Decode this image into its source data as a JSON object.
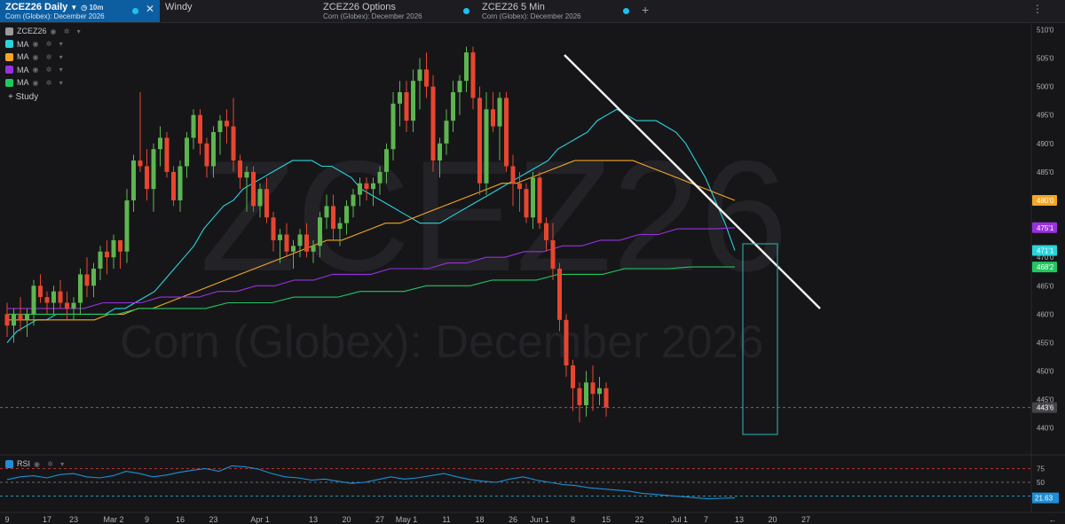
{
  "tabs": [
    {
      "title": "ZCEZ26 Daily",
      "subtitle": "Corn (Globex): December 2026",
      "interval": "10m"
    },
    {
      "title": "Windy",
      "subtitle": ""
    },
    {
      "title": "ZCEZ26 Options",
      "subtitle": "Corn (Globex): December 2026"
    },
    {
      "title": "ZCEZ26 5 Min",
      "subtitle": "Corn (Globex): December 2026"
    }
  ],
  "legend": [
    {
      "label": "ZCEZ26",
      "color": "#9a9a9a"
    },
    {
      "label": "MA",
      "color": "#2ad4dc"
    },
    {
      "label": "MA",
      "color": "#f5a623"
    },
    {
      "label": "MA",
      "color": "#9b30e0"
    },
    {
      "label": "MA",
      "color": "#22c760"
    }
  ],
  "study_label": "+ Study",
  "rsi_label": "RSI",
  "watermark": {
    "symbol": "ZCEZ26",
    "name": "Corn (Globex): December 2026"
  },
  "chart_data": {
    "type": "candlestick",
    "price_axis": {
      "ticks": [
        "510'0",
        "505'0",
        "500'0",
        "495'0",
        "490'0",
        "485'0",
        "480'0",
        "475'0",
        "470'0",
        "465'0",
        "460'0",
        "455'0",
        "450'0",
        "445'0",
        "440'0"
      ],
      "range": [
        437,
        511
      ]
    },
    "price_labels": [
      {
        "text": "480'0",
        "value": 480.0,
        "color": "#f5a623"
      },
      {
        "text": "475'1",
        "value": 475.2,
        "color": "#9b30e0"
      },
      {
        "text": "471'1",
        "value": 471.2,
        "color": "#2ad4dc"
      },
      {
        "text": "468'2",
        "value": 468.3,
        "color": "#22c760"
      },
      {
        "text": "443'6",
        "value": 443.6,
        "color": "#444449"
      }
    ],
    "last_price": 443.6,
    "x_ticks": [
      {
        "label": "9",
        "i": 0
      },
      {
        "label": "17",
        "i": 6
      },
      {
        "label": "23",
        "i": 10
      },
      {
        "label": "Mar 2",
        "i": 16
      },
      {
        "label": "9",
        "i": 21
      },
      {
        "label": "16",
        "i": 26
      },
      {
        "label": "23",
        "i": 31
      },
      {
        "label": "Apr 1",
        "i": 38
      },
      {
        "label": "13",
        "i": 46
      },
      {
        "label": "20",
        "i": 51
      },
      {
        "label": "27",
        "i": 56
      },
      {
        "label": "May 1",
        "i": 60
      },
      {
        "label": "11",
        "i": 66
      },
      {
        "label": "18",
        "i": 71
      },
      {
        "label": "26",
        "i": 76
      },
      {
        "label": "Jun 1",
        "i": 80
      },
      {
        "label": "8",
        "i": 85
      },
      {
        "label": "15",
        "i": 90
      },
      {
        "label": "22",
        "i": 95
      },
      {
        "label": "Jul 1",
        "i": 101
      },
      {
        "label": "7",
        "i": 105
      },
      {
        "label": "13",
        "i": 110
      },
      {
        "label": "20",
        "i": 115
      },
      {
        "label": "27",
        "i": 120
      }
    ],
    "candles": [
      [
        460,
        462,
        456,
        458
      ],
      [
        458,
        461,
        455,
        460
      ],
      [
        460,
        463,
        457,
        459
      ],
      [
        459,
        461,
        456,
        460
      ],
      [
        460,
        466,
        458,
        465
      ],
      [
        465,
        467,
        462,
        463
      ],
      [
        463,
        464,
        460,
        462
      ],
      [
        462,
        465,
        460,
        464
      ],
      [
        464,
        466,
        461,
        462
      ],
      [
        462,
        464,
        459,
        461
      ],
      [
        461,
        463,
        459,
        462
      ],
      [
        462,
        468,
        460,
        467
      ],
      [
        467,
        470,
        463,
        465
      ],
      [
        465,
        469,
        463,
        468
      ],
      [
        468,
        472,
        466,
        471
      ],
      [
        471,
        473,
        467,
        470
      ],
      [
        470,
        474,
        468,
        473
      ],
      [
        473,
        473,
        468,
        471
      ],
      [
        471,
        482,
        469,
        480
      ],
      [
        480,
        488,
        478,
        487
      ],
      [
        487,
        499,
        485,
        486
      ],
      [
        486,
        489,
        480,
        482
      ],
      [
        482,
        490,
        478,
        489
      ],
      [
        489,
        493,
        486,
        491
      ],
      [
        491,
        492,
        484,
        485
      ],
      [
        485,
        486,
        479,
        480
      ],
      [
        480,
        487,
        478,
        486
      ],
      [
        486,
        492,
        484,
        491
      ],
      [
        491,
        496,
        489,
        495
      ],
      [
        495,
        496,
        488,
        490
      ],
      [
        490,
        491,
        484,
        486
      ],
      [
        486,
        493,
        484,
        492
      ],
      [
        492,
        495,
        488,
        494
      ],
      [
        494,
        496,
        490,
        493
      ],
      [
        493,
        498,
        485,
        487
      ],
      [
        487,
        488,
        482,
        484
      ],
      [
        484,
        486,
        478,
        485
      ],
      [
        485,
        486,
        478,
        479
      ],
      [
        479,
        483,
        477,
        482
      ],
      [
        482,
        484,
        476,
        477
      ],
      [
        477,
        478,
        471,
        473
      ],
      [
        473,
        475,
        469,
        474
      ],
      [
        474,
        476,
        470,
        471
      ],
      [
        471,
        473,
        468,
        472
      ],
      [
        472,
        475,
        470,
        474
      ],
      [
        474,
        476,
        470,
        471
      ],
      [
        471,
        473,
        469,
        472
      ],
      [
        472,
        478,
        470,
        477
      ],
      [
        477,
        481,
        475,
        479
      ],
      [
        479,
        481,
        473,
        475
      ],
      [
        475,
        477,
        472,
        476
      ],
      [
        476,
        480,
        474,
        479
      ],
      [
        479,
        482,
        477,
        481
      ],
      [
        481,
        484,
        479,
        483
      ],
      [
        483,
        484,
        480,
        482
      ],
      [
        482,
        484,
        479,
        483
      ],
      [
        483,
        486,
        481,
        485
      ],
      [
        485,
        490,
        483,
        489
      ],
      [
        489,
        499,
        487,
        497
      ],
      [
        497,
        501,
        493,
        499
      ],
      [
        499,
        501,
        492,
        494
      ],
      [
        494,
        503,
        492,
        501
      ],
      [
        501,
        505,
        496,
        503
      ],
      [
        503,
        506,
        498,
        500
      ],
      [
        500,
        502,
        485,
        487
      ],
      [
        487,
        491,
        484,
        490
      ],
      [
        490,
        496,
        488,
        494
      ],
      [
        494,
        501,
        492,
        499
      ],
      [
        499,
        502,
        495,
        501
      ],
      [
        501,
        507,
        499,
        506
      ],
      [
        506,
        507,
        496,
        498
      ],
      [
        498,
        500,
        481,
        483
      ],
      [
        483,
        499,
        481,
        496
      ],
      [
        496,
        499,
        492,
        493
      ],
      [
        493,
        499,
        487,
        498
      ],
      [
        498,
        499,
        485,
        486
      ],
      [
        486,
        488,
        479,
        483
      ],
      [
        483,
        485,
        478,
        482
      ],
      [
        482,
        483,
        476,
        477
      ],
      [
        477,
        485,
        475,
        484
      ],
      [
        484,
        485,
        475,
        476
      ],
      [
        476,
        477,
        471,
        473
      ],
      [
        473,
        476,
        466,
        468
      ],
      [
        468,
        469,
        457,
        459
      ],
      [
        459,
        460,
        449,
        451
      ],
      [
        451,
        452,
        443,
        447
      ],
      [
        447,
        448,
        441,
        444
      ],
      [
        444,
        450,
        442,
        448
      ],
      [
        448,
        451,
        443,
        446
      ],
      [
        446,
        449,
        444,
        447
      ],
      [
        447,
        448,
        442,
        443.6
      ]
    ],
    "ma_series": [
      {
        "name": "MA",
        "color": "#2ad4dc",
        "values": [
          455,
          457,
          458,
          459,
          459,
          460,
          460,
          460,
          460,
          460,
          460,
          461,
          461,
          462,
          463,
          464,
          466,
          468,
          470,
          472,
          475,
          477,
          479,
          480,
          482,
          483,
          484,
          485,
          486,
          487,
          487,
          487,
          486,
          486,
          485,
          484,
          482,
          481,
          480,
          479,
          478,
          477,
          476,
          476,
          476,
          477,
          478,
          479,
          480,
          481,
          482,
          483,
          484,
          485,
          486,
          487,
          489,
          490,
          491,
          492,
          494,
          495,
          496,
          495,
          494,
          494,
          494,
          493,
          492,
          490,
          487,
          484,
          480,
          476,
          471.2
        ]
      },
      {
        "name": "MA",
        "color": "#f5a623",
        "values": [
          459,
          459,
          459,
          459,
          459,
          459,
          459,
          460,
          460,
          461,
          461,
          462,
          463,
          464,
          465,
          466,
          467,
          468,
          469,
          470,
          471,
          472,
          473,
          473,
          474,
          475,
          476,
          476,
          477,
          478,
          479,
          480,
          481,
          482,
          483,
          483,
          484,
          485,
          486,
          487,
          487,
          487,
          487,
          487,
          486,
          485,
          484,
          483,
          482,
          481,
          480
        ]
      },
      {
        "name": "MA",
        "color": "#9b30e0",
        "values": [
          461,
          461,
          461,
          461,
          461,
          462,
          462,
          462,
          463,
          463,
          463,
          464,
          464,
          465,
          465,
          466,
          466,
          467,
          467,
          467,
          468,
          468,
          468,
          469,
          469,
          470,
          470,
          471,
          471,
          472,
          472,
          473,
          473,
          474,
          474,
          475,
          475,
          475,
          475.2
        ]
      },
      {
        "name": "MA",
        "color": "#22c760",
        "values": [
          460,
          460,
          460,
          460,
          460,
          460,
          461,
          461,
          461,
          461,
          462,
          462,
          462,
          463,
          463,
          463,
          464,
          464,
          464,
          465,
          465,
          465,
          466,
          466,
          466,
          467,
          467,
          467,
          468,
          468,
          468,
          468.3,
          468.3,
          468.3
        ]
      }
    ],
    "rsi": {
      "levels": [
        75,
        50,
        25
      ],
      "last": "21.63",
      "values": [
        55,
        60,
        62,
        58,
        64,
        66,
        60,
        58,
        62,
        70,
        66,
        60,
        63,
        68,
        72,
        75,
        70,
        80,
        78,
        74,
        66,
        60,
        58,
        54,
        56,
        52,
        48,
        50,
        55,
        60,
        56,
        58,
        62,
        66,
        60,
        55,
        52,
        50,
        56,
        60,
        54,
        50,
        46,
        44,
        40,
        38,
        36,
        34,
        30,
        28,
        26,
        24,
        22,
        20,
        21,
        21.63
      ]
    }
  }
}
